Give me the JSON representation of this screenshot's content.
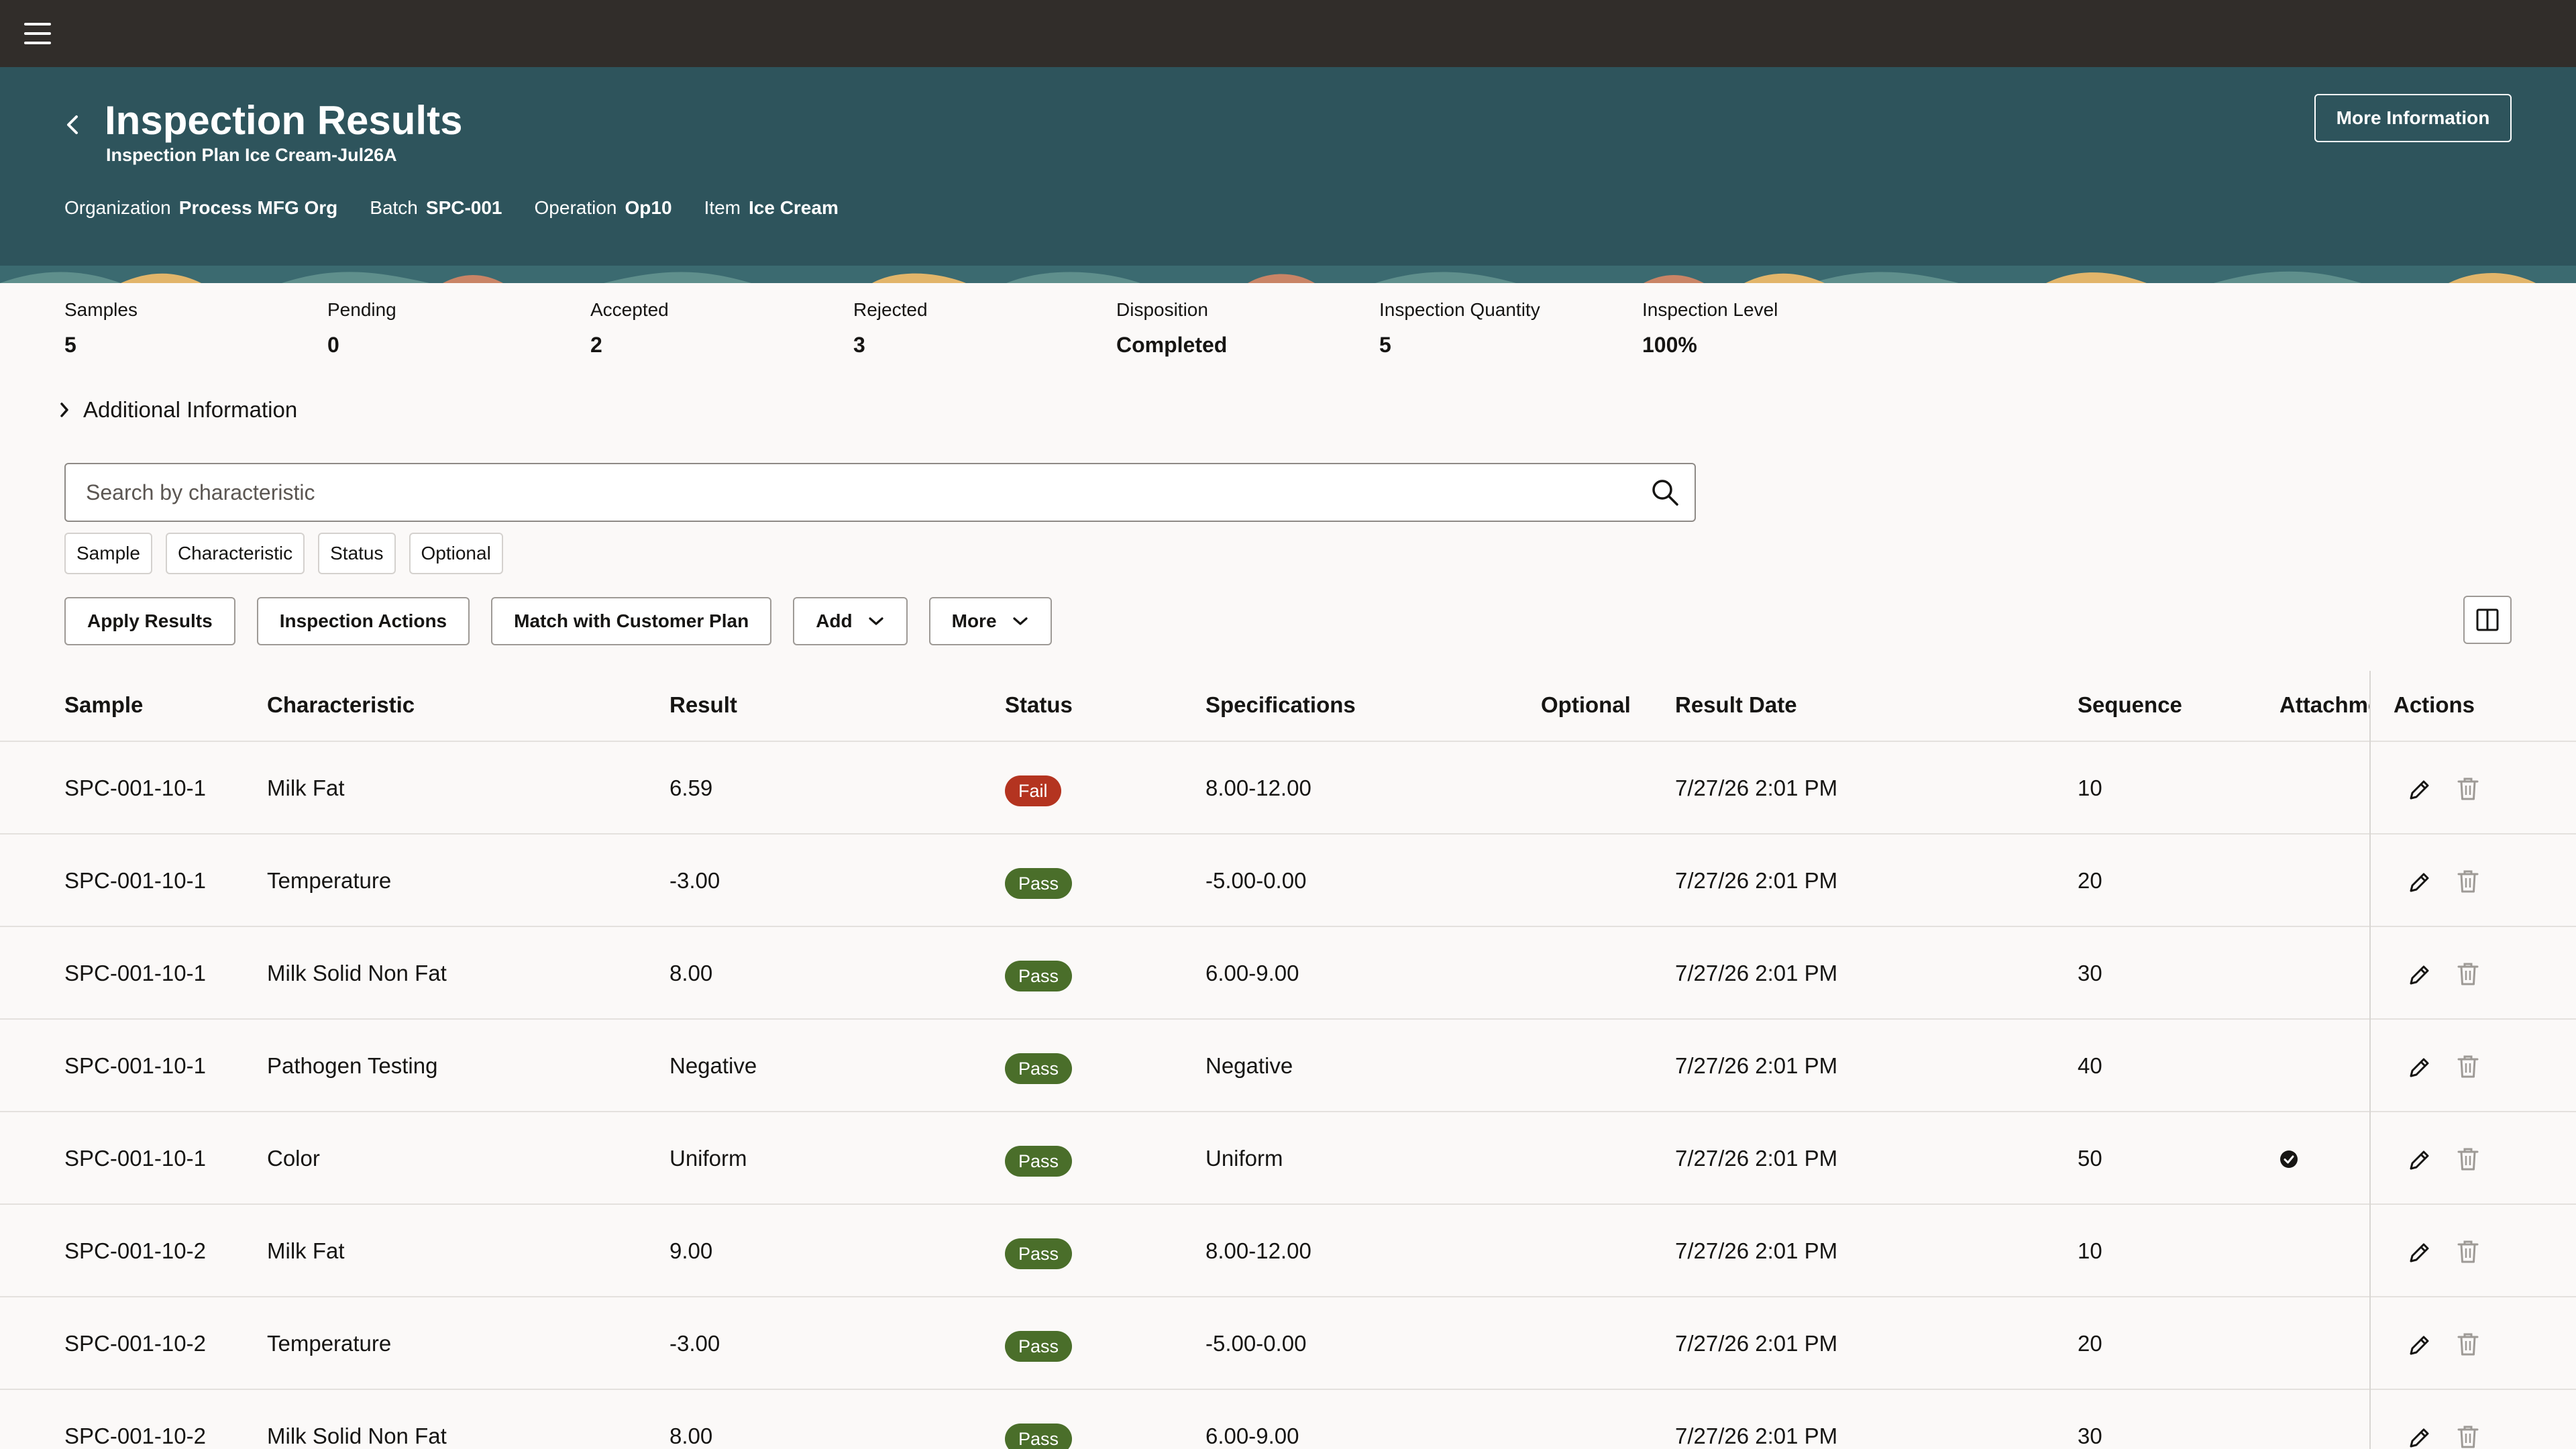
{
  "header": {
    "title": "Inspection Results",
    "subtitle": "Inspection Plan Ice Cream-Jul26A",
    "more_info_label": "More Information",
    "meta": [
      {
        "label": "Organization",
        "value": "Process MFG Org"
      },
      {
        "label": "Batch",
        "value": "SPC-001"
      },
      {
        "label": "Operation",
        "value": "Op10"
      },
      {
        "label": "Item",
        "value": "Ice Cream"
      }
    ]
  },
  "summary": [
    {
      "label": "Samples",
      "value": "5"
    },
    {
      "label": "Pending",
      "value": "0"
    },
    {
      "label": "Accepted",
      "value": "2"
    },
    {
      "label": "Rejected",
      "value": "3"
    },
    {
      "label": "Disposition",
      "value": "Completed"
    },
    {
      "label": "Inspection Quantity",
      "value": "5"
    },
    {
      "label": "Inspection Level",
      "value": "100%"
    }
  ],
  "additional_info_label": "Additional Information",
  "search": {
    "placeholder": "Search by characteristic"
  },
  "filters": [
    "Sample",
    "Characteristic",
    "Status",
    "Optional"
  ],
  "toolbar": {
    "apply_results": "Apply Results",
    "inspection_actions": "Inspection Actions",
    "match_customer_plan": "Match with Customer Plan",
    "add": "Add",
    "more": "More"
  },
  "table": {
    "columns": {
      "sample": "Sample",
      "characteristic": "Characteristic",
      "result": "Result",
      "status": "Status",
      "specifications": "Specifications",
      "optional": "Optional",
      "result_date": "Result Date",
      "sequence": "Sequence",
      "attachments": "Attachme",
      "actions": "Actions"
    },
    "rows": [
      {
        "sample": "SPC-001-10-1",
        "characteristic": "Milk Fat",
        "result": "6.59",
        "status": "Fail",
        "specifications": "8.00-12.00",
        "result_date": "7/27/26 2:01 PM",
        "sequence": "10",
        "attachment": false
      },
      {
        "sample": "SPC-001-10-1",
        "characteristic": "Temperature",
        "result": "-3.00",
        "status": "Pass",
        "specifications": "-5.00-0.00",
        "result_date": "7/27/26 2:01 PM",
        "sequence": "20",
        "attachment": false
      },
      {
        "sample": "SPC-001-10-1",
        "characteristic": "Milk Solid Non Fat",
        "result": "8.00",
        "status": "Pass",
        "specifications": "6.00-9.00",
        "result_date": "7/27/26 2:01 PM",
        "sequence": "30",
        "attachment": false
      },
      {
        "sample": "SPC-001-10-1",
        "characteristic": "Pathogen Testing",
        "result": "Negative",
        "status": "Pass",
        "specifications": "Negative",
        "result_date": "7/27/26 2:01 PM",
        "sequence": "40",
        "attachment": false
      },
      {
        "sample": "SPC-001-10-1",
        "characteristic": "Color",
        "result": "Uniform",
        "status": "Pass",
        "specifications": "Uniform",
        "result_date": "7/27/26 2:01 PM",
        "sequence": "50",
        "attachment": true
      },
      {
        "sample": "SPC-001-10-2",
        "characteristic": "Milk Fat",
        "result": "9.00",
        "status": "Pass",
        "specifications": "8.00-12.00",
        "result_date": "7/27/26 2:01 PM",
        "sequence": "10",
        "attachment": false
      },
      {
        "sample": "SPC-001-10-2",
        "characteristic": "Temperature",
        "result": "-3.00",
        "status": "Pass",
        "specifications": "-5.00-0.00",
        "result_date": "7/27/26 2:01 PM",
        "sequence": "20",
        "attachment": false
      },
      {
        "sample": "SPC-001-10-2",
        "characteristic": "Milk Solid Non Fat",
        "result": "8.00",
        "status": "Pass",
        "specifications": "6.00-9.00",
        "result_date": "7/27/26 2:01 PM",
        "sequence": "30",
        "attachment": false
      }
    ]
  },
  "colors": {
    "top_bar": "#312d2a",
    "header": "#2e545c",
    "fail": "#b43420",
    "pass": "#4a6e2a"
  },
  "icons": {
    "menu": "hamburger-icon",
    "back": "chevron-left-icon",
    "search": "search-icon",
    "expand": "chevron-right-icon",
    "dropdown": "chevron-down-icon",
    "layout": "column-layout-icon",
    "attachment": "check-circle-icon",
    "edit": "pencil-icon",
    "delete": "trash-icon"
  }
}
